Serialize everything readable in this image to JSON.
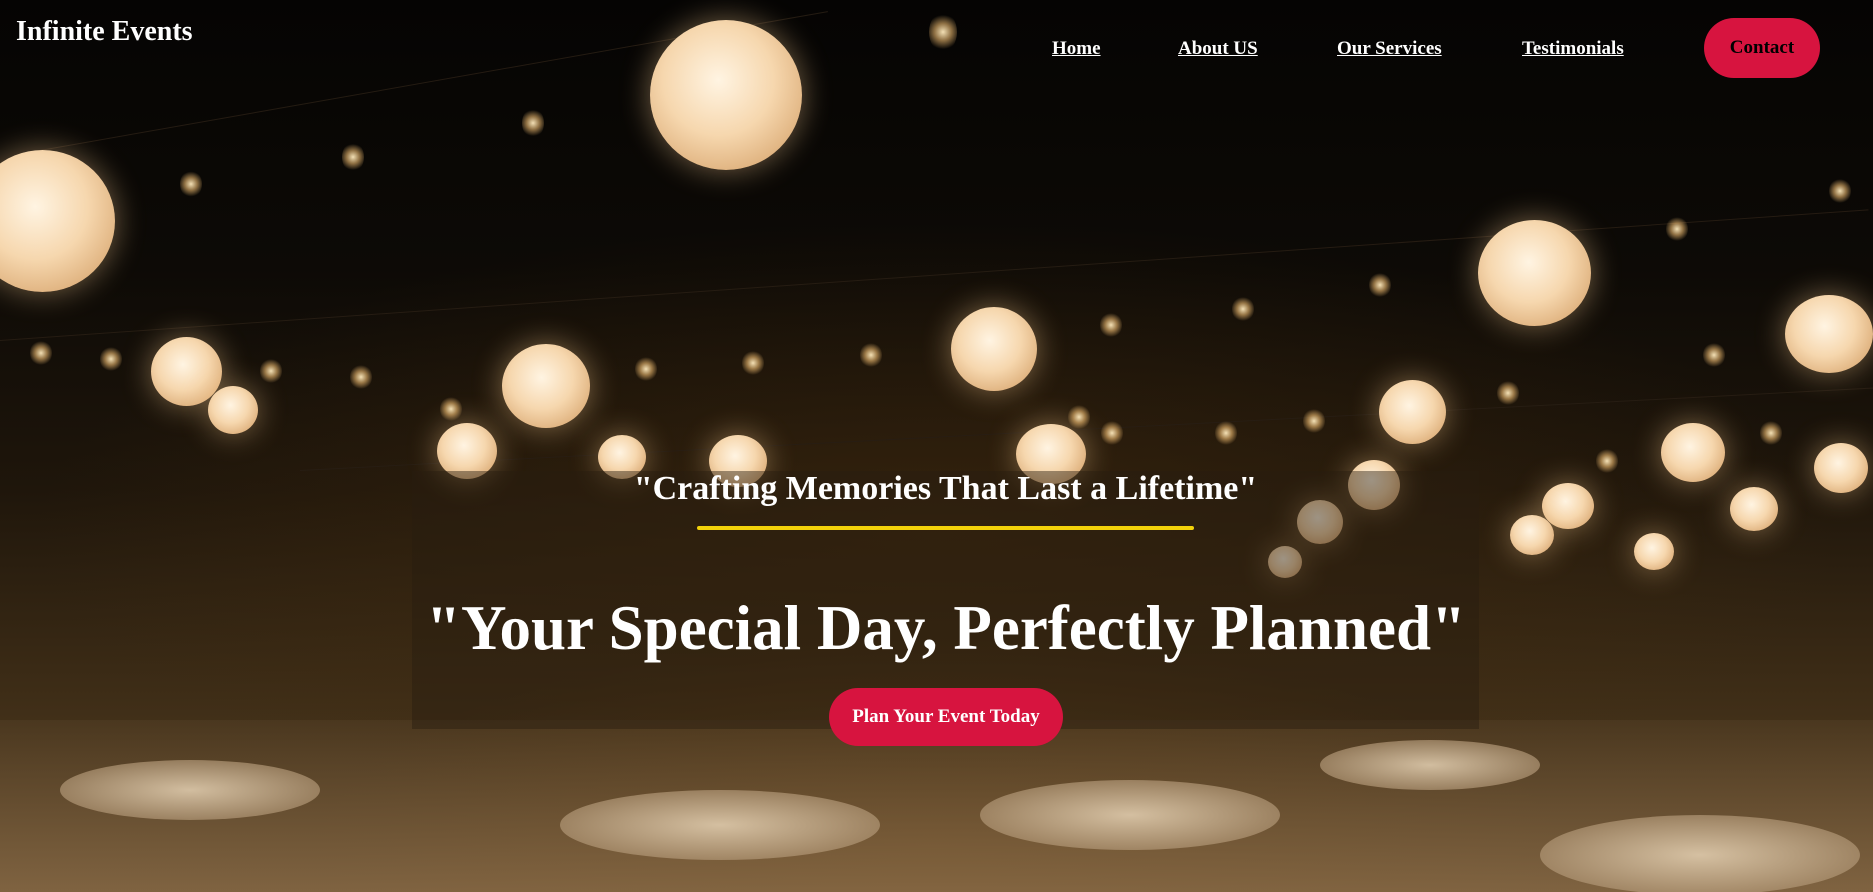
{
  "brand": {
    "name": "Infinite Events"
  },
  "nav": {
    "items": [
      {
        "label": "Home"
      },
      {
        "label": "About US"
      },
      {
        "label": "Our Services"
      },
      {
        "label": "Testimonials"
      }
    ],
    "contact_label": "Contact"
  },
  "hero": {
    "tagline": "\"Crafting Memories That Last a Lifetime\"",
    "headline": "\"Your Special Day, Perfectly Planned\"",
    "cta_label": "Plan Your Event Today"
  },
  "colors": {
    "accent": "#d7143f",
    "underline": "#f2d20a",
    "text": "#ffffff"
  }
}
